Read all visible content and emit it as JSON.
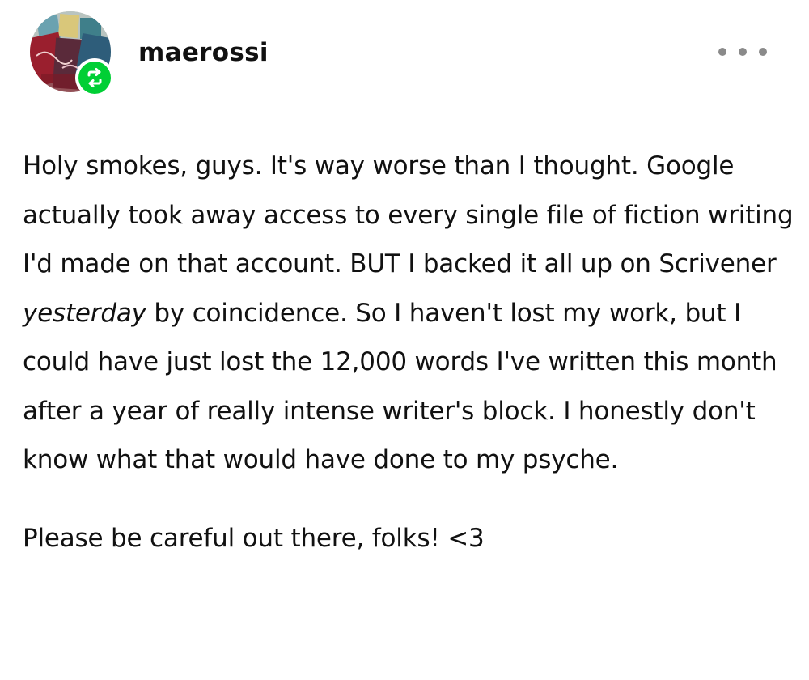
{
  "post": {
    "username": "maerossi",
    "more_icon": "more-horizontal-icon",
    "reblog_icon": "reblog-icon",
    "paragraphs": {
      "p1_before": "Holy smokes, guys. It's way worse than I thought. Google actually took away access to every single file of fiction writing I'd made on that account. BUT I backed it all up on Scrivener ",
      "p1_italic": "yesterday",
      "p1_after": " by coincidence. So I haven't lost my work, but I could have just lost the 12,000 words I've written this month after a year of really intense writer's block. I honestly don't know what that would have done to my psyche.",
      "p2": "Please be careful out there, folks! <3"
    }
  },
  "colors": {
    "badge_green": "#00cf35",
    "text": "#111111",
    "more_dots": "#8a8a8a"
  }
}
